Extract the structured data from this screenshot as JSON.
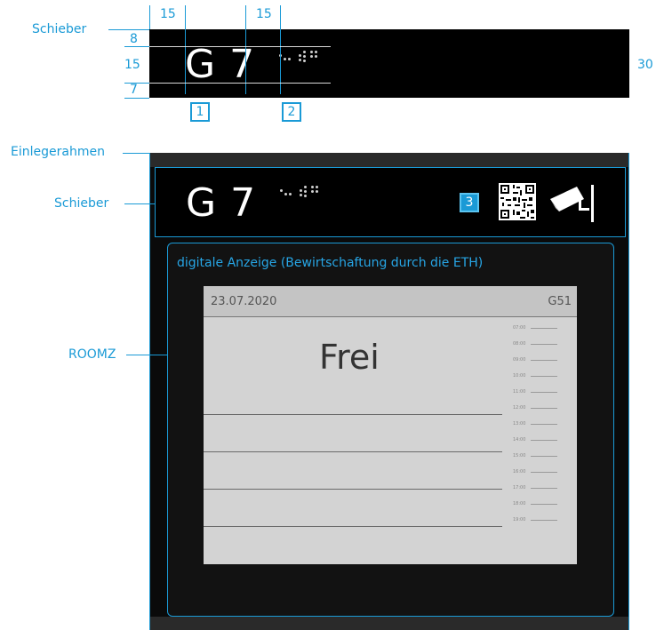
{
  "labels": {
    "schieber_top": "Schieber",
    "einlegerahmen": "Einlegerahmen",
    "schieber_mid": "Schieber",
    "roomz": "ROOMZ"
  },
  "dimensions": {
    "top_left": "15",
    "top_right": "15",
    "d8": "8",
    "d15": "15",
    "d7": "7",
    "d30": "30"
  },
  "markers": [
    "1",
    "2",
    "3"
  ],
  "sign": {
    "room_code": "G 7"
  },
  "display": {
    "caption": "digitale Anzeige (Bewirtschaftung durch die ETH)",
    "date": "23.07.2020",
    "room": "G51",
    "status": "Frei",
    "times": [
      "07:00",
      "08:00",
      "09:00",
      "10:00",
      "11:00",
      "12:00",
      "13:00",
      "14:00",
      "15:00",
      "16:00",
      "17:00",
      "18:00",
      "19:00"
    ]
  },
  "icons": {
    "braille": "braille-dots-icon",
    "qr": "qr-code-icon",
    "camera": "security-camera-icon"
  },
  "colors": {
    "accent": "#1a9ad6",
    "frame": "#0a0a0a",
    "display_bg": "#d3d3d3"
  }
}
